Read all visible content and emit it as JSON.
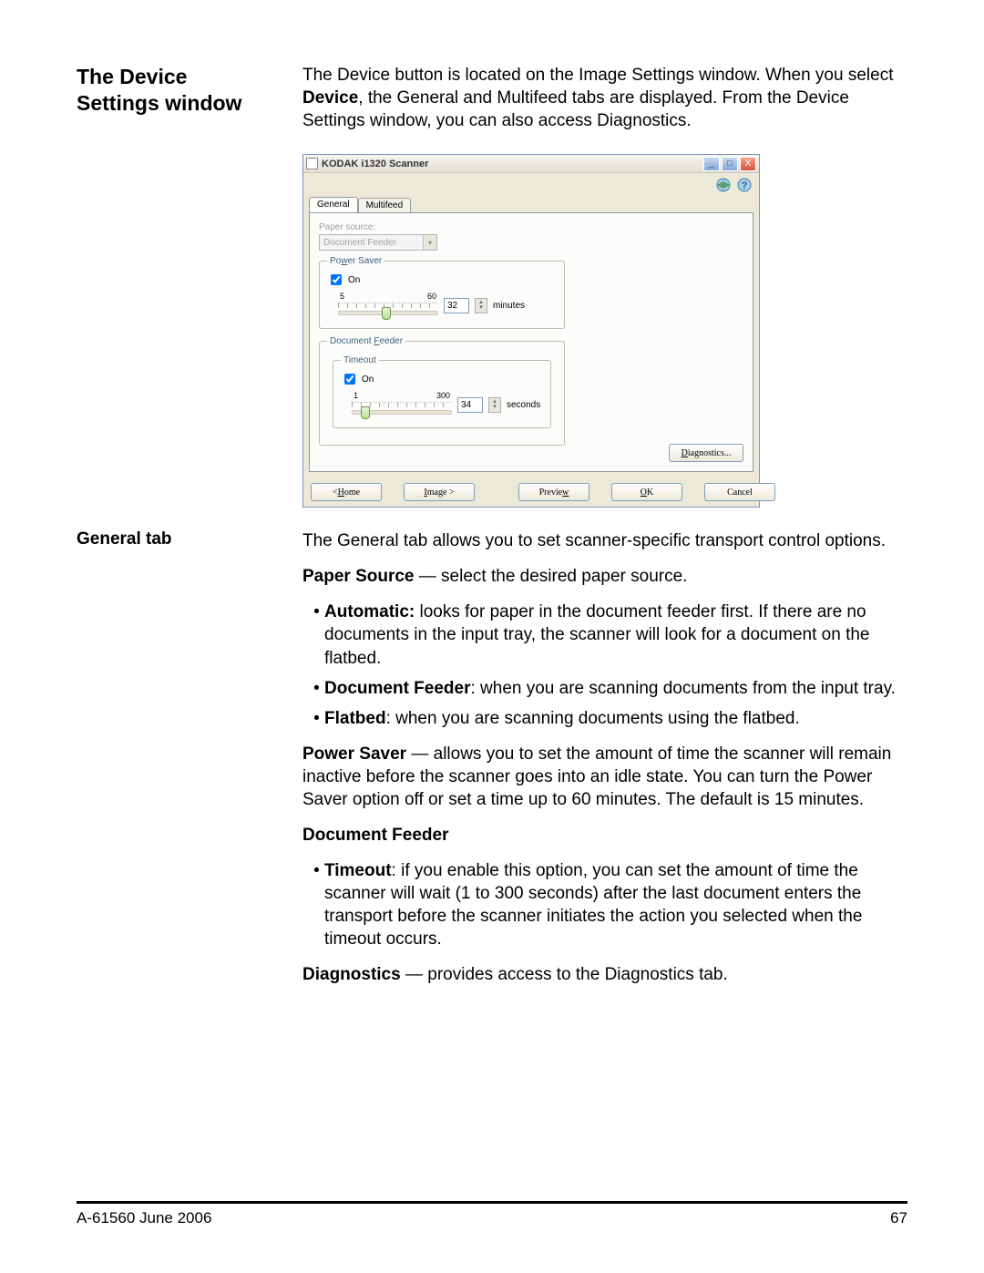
{
  "heading1": "The Device Settings window",
  "intro_part1": "The Device button is located on the Image Settings window. When you select ",
  "intro_bold": "Device",
  "intro_part2": ", the General and Multifeed tabs are displayed. From the Device Settings window, you can also access Diagnostics.",
  "subhead": "General tab",
  "general_intro": "The General tab allows you to set scanner-specific transport control options.",
  "paper_source_bold": "Paper Source",
  "paper_source_rest": " — select the desired paper source.",
  "bullet_auto_bold": "Automatic:",
  "bullet_auto_rest": " looks for paper in the document feeder first. If there are no documents in the input tray, the scanner will look for a document on the flatbed.",
  "bullet_df_bold": "Document Feeder",
  "bullet_df_rest": ": when you are scanning documents from the input tray.",
  "bullet_fb_bold": "Flatbed",
  "bullet_fb_rest": ": when you are scanning documents using the flatbed.",
  "ps_bold": "Power Saver",
  "ps_rest": " — allows you to set the amount of time the scanner will remain inactive before the scanner goes into an idle state. You can turn the Power Saver option off or set a time up to 60 minutes. The default is 15 minutes.",
  "df_heading": "Document Feeder",
  "bullet_timeout_bold": "Timeout",
  "bullet_timeout_rest": ": if you enable this option, you can set the amount of time the scanner will wait (1 to 300 seconds) after the last document enters the transport before the scanner initiates the action you selected when the timeout occurs.",
  "diag_bold": "Diagnostics",
  "diag_rest": " — provides access to the Diagnostics tab.",
  "footer_left": "A-61560   June 2006",
  "footer_right": "67",
  "win": {
    "title": "KODAK i1320 Scanner",
    "min": "_",
    "max": "□",
    "close": "X",
    "tab_general": "General",
    "tab_multifeed": "Multifeed",
    "paper_source_label": "Paper source:",
    "paper_source_value": "Document Feeder",
    "power_saver_legend": "Power Saver",
    "on_label": "On",
    "ps_min": "5",
    "ps_max": "60",
    "ps_value": "32",
    "ps_unit": "minutes",
    "df_legend": "Document Feeder",
    "timeout_legend": "Timeout",
    "to_min": "1",
    "to_max": "300",
    "to_value": "34",
    "to_unit": "seconds",
    "diagnostics_btn": "Diagnostics...",
    "home_btn": "< Home",
    "image_btn": "Image >",
    "preview_btn": "Preview",
    "ok_btn": "OK",
    "cancel_btn": "Cancel"
  }
}
